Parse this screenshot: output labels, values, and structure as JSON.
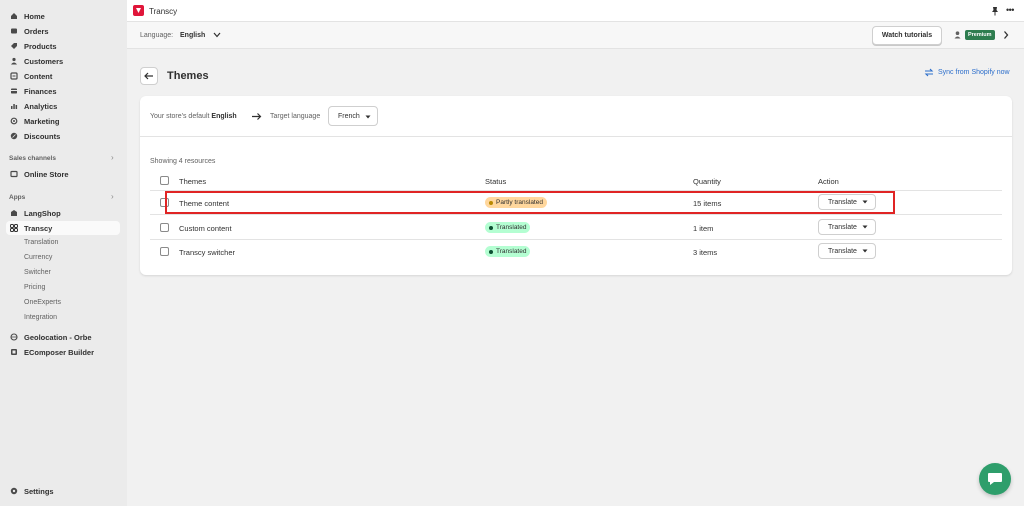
{
  "sidebar": {
    "main_items": [
      {
        "label": "Home",
        "icon": "home-icon"
      },
      {
        "label": "Orders",
        "icon": "orders-icon"
      },
      {
        "label": "Products",
        "icon": "products-icon"
      },
      {
        "label": "Customers",
        "icon": "customers-icon"
      },
      {
        "label": "Content",
        "icon": "content-icon"
      },
      {
        "label": "Finances",
        "icon": "finances-icon"
      },
      {
        "label": "Analytics",
        "icon": "analytics-icon"
      },
      {
        "label": "Marketing",
        "icon": "marketing-icon"
      },
      {
        "label": "Discounts",
        "icon": "discounts-icon"
      }
    ],
    "sales_channels_label": "Sales channels",
    "online_store": "Online Store",
    "apps_label": "Apps",
    "langshop": "LangShop",
    "transcy": "Transcy",
    "transcy_sub": [
      "Translation",
      "Currency",
      "Switcher",
      "Pricing",
      "OneExperts",
      "Integration"
    ],
    "geolocation": "Geolocation - Orbe",
    "ecomposer": "EComposer Builder",
    "settings": "Settings"
  },
  "topbar": {
    "app_name": "Transcy",
    "language_label": "Language:",
    "language_value": "English",
    "watch_tutorials": "Watch tutorials",
    "premium_badge": "Premium"
  },
  "page": {
    "title": "Themes",
    "sync_link": "Sync from Shopify now",
    "default_prefix": "Your store's default",
    "default_language": "English",
    "target_label": "Target language",
    "target_value": "French",
    "showing": "Showing 4 resources"
  },
  "table": {
    "headers": {
      "name": "Themes",
      "status": "Status",
      "quantity": "Quantity",
      "action": "Action"
    },
    "rows": [
      {
        "name": "Theme content",
        "status": "Partly translated",
        "quantity": "15 items",
        "action": "Translate"
      },
      {
        "name": "Custom content",
        "status": "Translated",
        "quantity": "1 item",
        "action": "Translate"
      },
      {
        "name": "Transcy switcher",
        "status": "Translated",
        "quantity": "3 items",
        "action": "Translate"
      }
    ]
  },
  "colors": {
    "accent_red": "#e02424",
    "premium_green": "#2e7d4f",
    "link_blue": "#2c6ecb",
    "partial_badge": "#ffd79d",
    "translated_badge": "#b4fed2",
    "chat_green": "#2e9e6b"
  }
}
